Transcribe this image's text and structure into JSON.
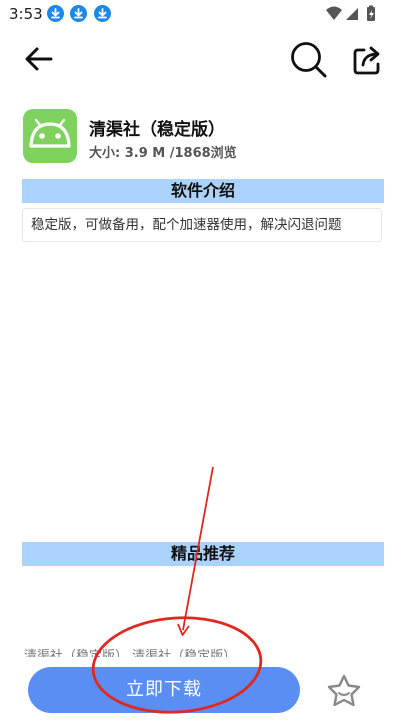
{
  "status_bar": {
    "time": "3:53",
    "download_badges": 3,
    "icons": [
      "download-icon",
      "wifi-icon",
      "signal-icon",
      "battery-icon"
    ]
  },
  "toolbar": {
    "back_icon": "back-arrow-icon",
    "search_icon": "search-icon",
    "share_icon": "share-icon"
  },
  "app": {
    "name": "清渠社（稳定版）",
    "meta": "大小: 3.9 M /1868浏览",
    "icon": "android-icon",
    "icon_color": "#7fd25d"
  },
  "sections": {
    "intro_title": "软件介绍",
    "intro_text": "稳定版，可做备用，配个加速器使用，解决闪退问题",
    "recommend_title": "精品推荐",
    "recommend_peek_text": "清渠社（稳定版） 清渠社（稳定版）"
  },
  "bottom_bar": {
    "download_label": "立即下载",
    "favorite_icon": "star-icon"
  },
  "colors": {
    "accent_blue": "#5b8ef3",
    "section_header_bg": "#aad2fb",
    "status_badge_blue": "#1e88e5",
    "annotation_red": "#e0281e"
  }
}
